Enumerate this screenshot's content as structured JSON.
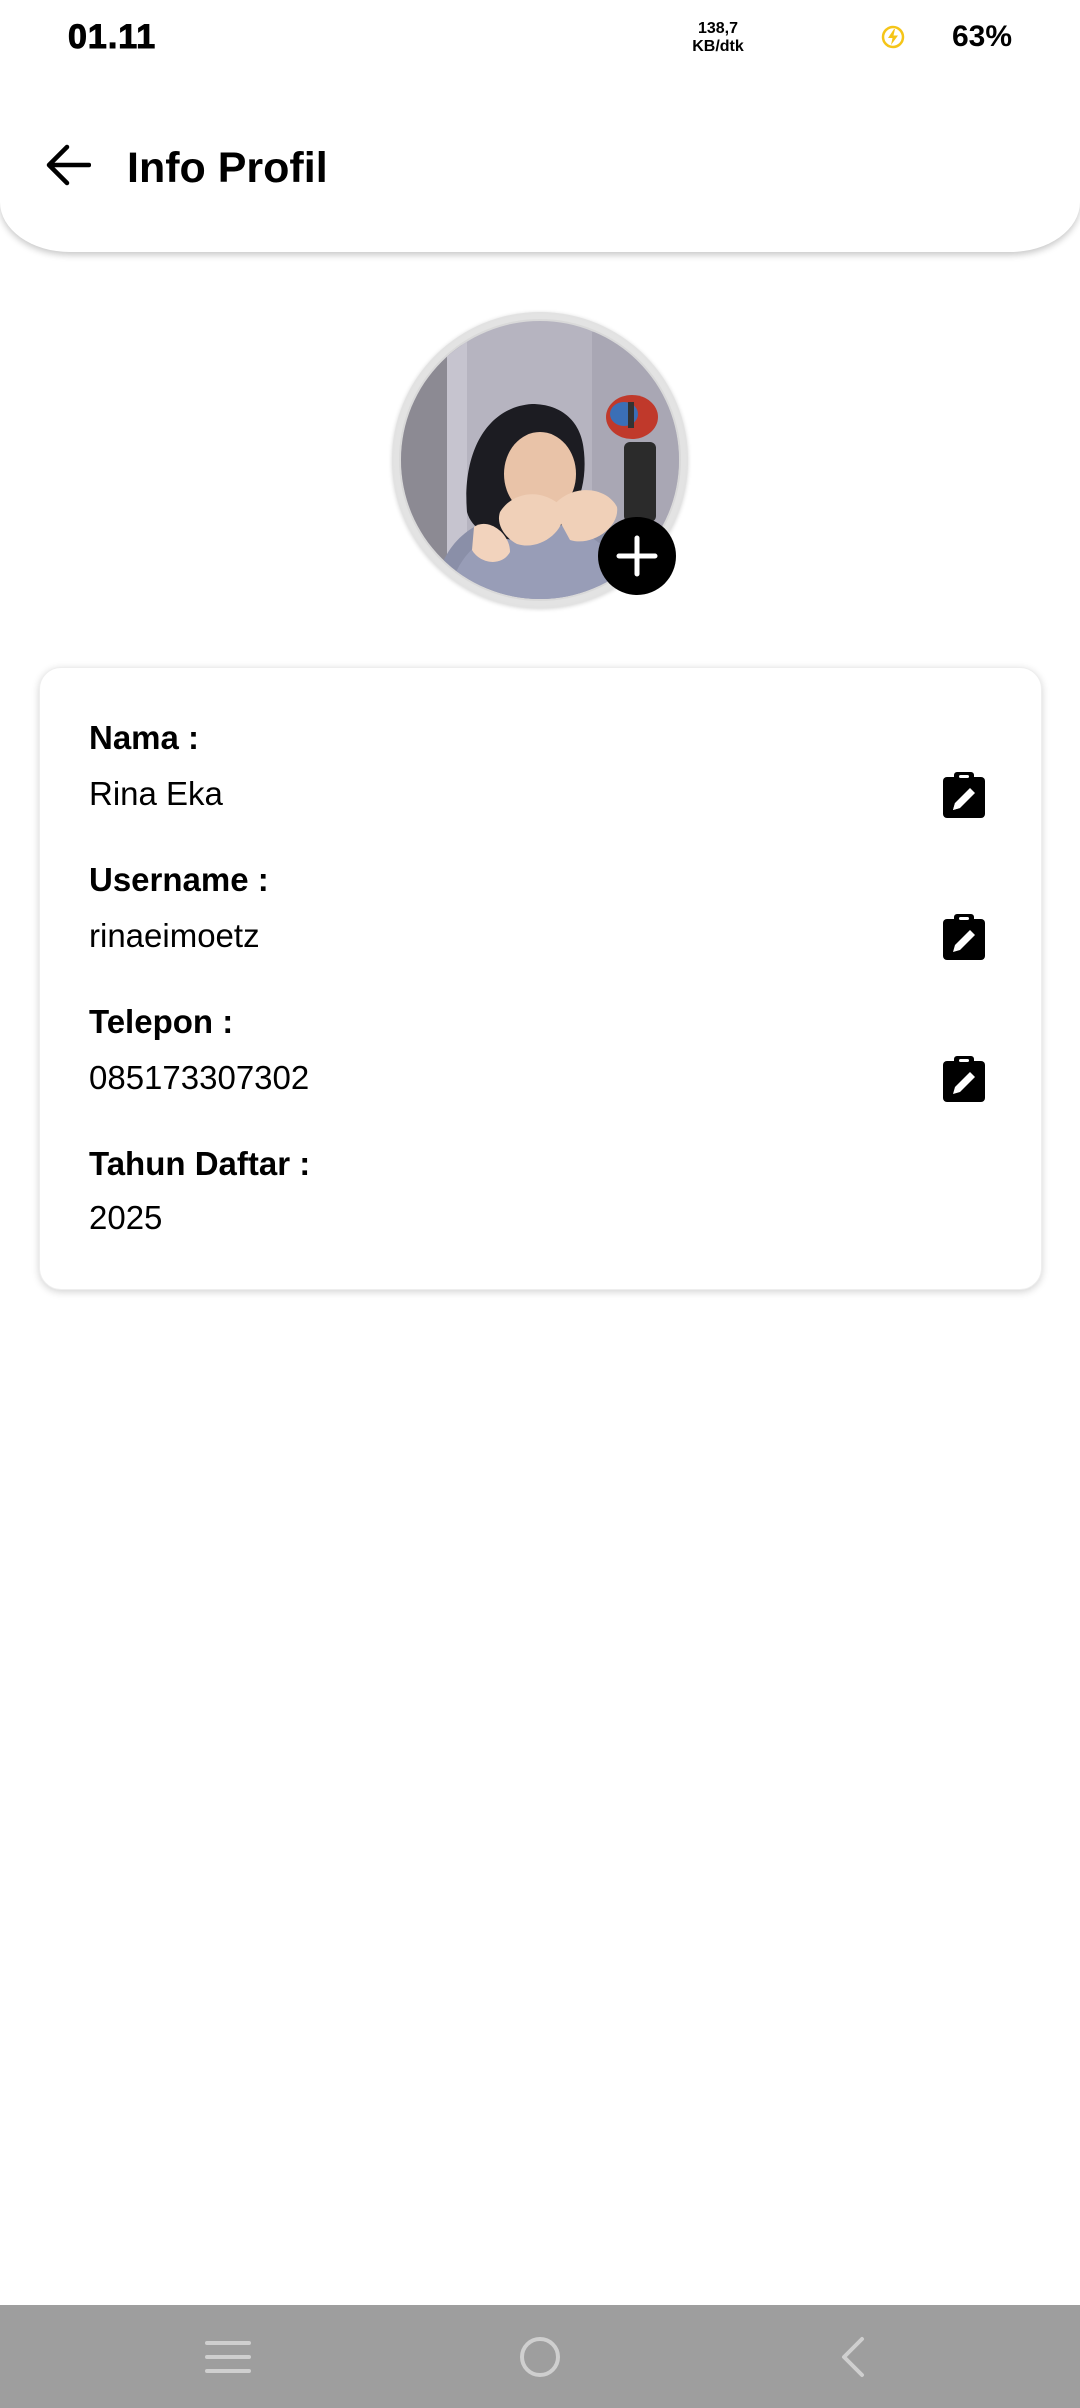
{
  "status_bar": {
    "time": "01.11",
    "net_speed_value": "138,7",
    "net_speed_unit": "KB/dtk",
    "battery": "63%",
    "charging_icon": "lightning-bolt-icon",
    "charging_color": "#F5C518"
  },
  "header": {
    "back_icon": "arrow-left-icon",
    "title": "Info Profil"
  },
  "avatar": {
    "add_photo_icon": "plus-circle-icon"
  },
  "profile": {
    "fields": [
      {
        "label": "Nama :",
        "value": "Rina Eka",
        "edit_icon": "clipboard-edit-icon"
      },
      {
        "label": "Username :",
        "value": "rinaeimoetz",
        "edit_icon": "clipboard-edit-icon"
      },
      {
        "label": "Telepon :",
        "value": "085173307302",
        "edit_icon": "clipboard-edit-icon"
      },
      {
        "label": "Tahun Daftar :",
        "value": "2025"
      }
    ]
  },
  "nav_bar": {
    "buttons": [
      "menu-icon",
      "home-circle-icon",
      "back-chevron-icon"
    ]
  },
  "colors": {
    "background": "#FFFFFF",
    "nav_bar": "#9E9E9E",
    "text": "#000000",
    "icon": "#000000"
  }
}
